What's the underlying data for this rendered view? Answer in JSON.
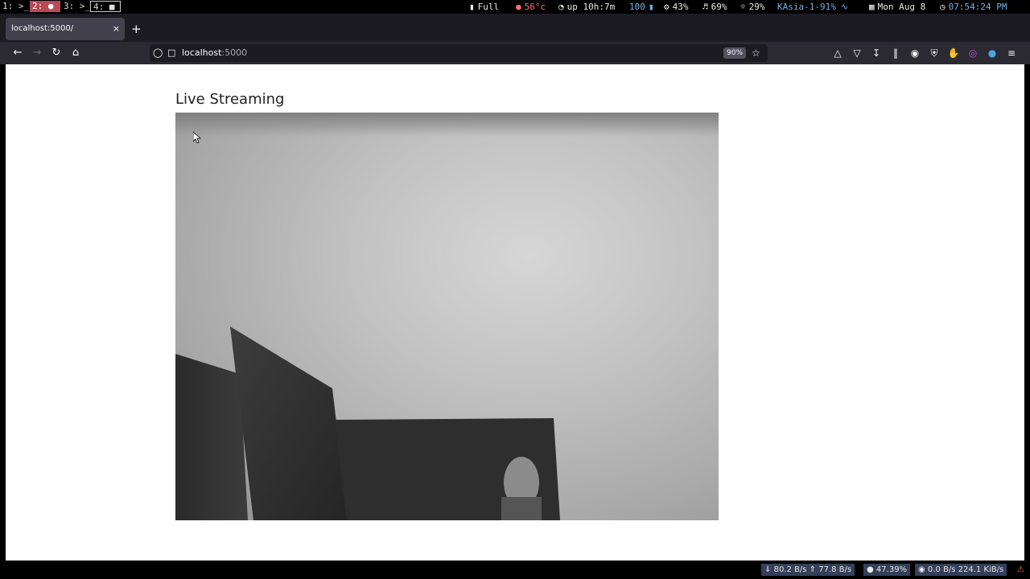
{
  "topbar": {
    "workspaces": [
      {
        "num": "1:",
        "icon": ">_"
      },
      {
        "num": "2:",
        "icon": "●"
      },
      {
        "num": "3:",
        "icon": ">_"
      },
      {
        "num": "4:",
        "icon": "■"
      }
    ],
    "battery": "Full",
    "temp": "56°c",
    "uptime": "up 10h:7m",
    "brightness": "100",
    "cpu": "43%",
    "volume": "69%",
    "load": "29%",
    "network": "KAsia-1-91%",
    "date": "Mon Aug 8",
    "time": "07:54:24 PM"
  },
  "browser": {
    "tab_title": "localhost:5000/",
    "tab_close": "×",
    "new_tab": "+",
    "url_host": "localhost",
    "url_port": ":5000",
    "zoom": "90%"
  },
  "page": {
    "title": "Live Streaming"
  },
  "bottombar": {
    "down_rate": "80.2 B/s",
    "up_rate": "77.8 B/s",
    "disk": "47.39%",
    "disk_io": "0.0 B/s 224.1 KiB/s"
  },
  "colors": {
    "workspace_active": "#b84a55",
    "temp": "#ff6b6b",
    "accent_blue": "#6fb3e0",
    "bottom_segment": "#34405a"
  }
}
